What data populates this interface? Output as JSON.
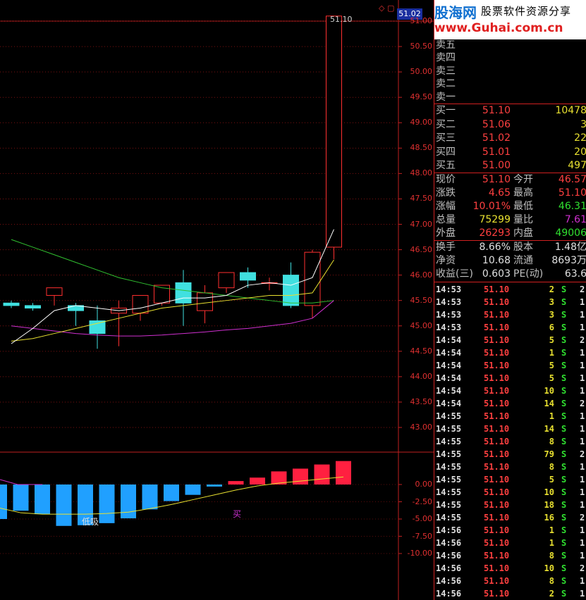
{
  "chart": {
    "current_price_tag": "51.02",
    "top_price_label": "51.10",
    "top_icons": "◇ ▢",
    "price_axis": [
      "51.00",
      "50.50",
      "50.00",
      "49.50",
      "49.00",
      "48.50",
      "48.00",
      "47.50",
      "47.00",
      "46.50",
      "46.00",
      "45.50",
      "45.00",
      "44.50",
      "44.00",
      "43.50",
      "43.00"
    ],
    "macd_axis": [
      "0.00",
      "-2.50",
      "-5.00",
      "-7.50",
      "-10.00"
    ],
    "signal_low": "低吸",
    "signal_buy": "买",
    "colors": {
      "up": "#ff3030",
      "down": "#40e0e0",
      "ma5": "#ffffff",
      "ma10": "#e8e030",
      "ma20": "#30c030",
      "ma60": "#d030d0"
    }
  },
  "panel": {
    "logo": {
      "site": "股海网",
      "tagline": "股票软件资源分享",
      "url": "www.Guhai.com.cn"
    },
    "sell": [
      {
        "label": "卖五",
        "price": "",
        "vol": ""
      },
      {
        "label": "卖四",
        "price": "",
        "vol": ""
      },
      {
        "label": "卖三",
        "price": "",
        "vol": ""
      },
      {
        "label": "卖二",
        "price": "",
        "vol": ""
      },
      {
        "label": "卖一",
        "price": "",
        "vol": ""
      }
    ],
    "buy": [
      {
        "label": "买一",
        "price": "51.10",
        "vol": "10478"
      },
      {
        "label": "买二",
        "price": "51.06",
        "vol": "3"
      },
      {
        "label": "买三",
        "price": "51.02",
        "vol": "22"
      },
      {
        "label": "买四",
        "price": "51.01",
        "vol": "20"
      },
      {
        "label": "买五",
        "price": "51.00",
        "vol": "497"
      }
    ],
    "quote": [
      {
        "l1": "现价",
        "v1": "51.10",
        "c1": "c-red",
        "l2": "今开",
        "v2": "46.57",
        "c2": "c-red"
      },
      {
        "l1": "涨跌",
        "v1": "4.65",
        "c1": "c-red",
        "l2": "最高",
        "v2": "51.10",
        "c2": "c-red"
      },
      {
        "l1": "涨幅",
        "v1": "10.01%",
        "c1": "c-red",
        "l2": "最低",
        "v2": "46.31",
        "c2": "c-green"
      },
      {
        "l1": "总量",
        "v1": "75299",
        "c1": "c-yel",
        "l2": "量比",
        "v2": "7.61",
        "c2": "c-mag"
      },
      {
        "l1": "外盘",
        "v1": "26293",
        "c1": "c-red",
        "l2": "内盘",
        "v2": "49006",
        "c2": "c-green"
      }
    ],
    "fund": [
      {
        "l1": "换手",
        "v1": "8.66%",
        "l2": "股本",
        "v2": "1.48亿"
      },
      {
        "l1": "净资",
        "v1": "10.68",
        "l2": "流通",
        "v2": "8693万"
      },
      {
        "l1": "收益(三)",
        "v1": "0.603",
        "l2": "PE(动)",
        "v2": "63.6"
      }
    ],
    "ticks": [
      {
        "t": "14:53",
        "p": "51.10",
        "v": "2",
        "s": "S",
        "x": "2"
      },
      {
        "t": "14:53",
        "p": "51.10",
        "v": "3",
        "s": "S",
        "x": "1"
      },
      {
        "t": "14:53",
        "p": "51.10",
        "v": "3",
        "s": "S",
        "x": "1"
      },
      {
        "t": "14:53",
        "p": "51.10",
        "v": "6",
        "s": "S",
        "x": "1"
      },
      {
        "t": "14:54",
        "p": "51.10",
        "v": "5",
        "s": "S",
        "x": "2"
      },
      {
        "t": "14:54",
        "p": "51.10",
        "v": "1",
        "s": "S",
        "x": "1"
      },
      {
        "t": "14:54",
        "p": "51.10",
        "v": "5",
        "s": "S",
        "x": "1"
      },
      {
        "t": "14:54",
        "p": "51.10",
        "v": "5",
        "s": "S",
        "x": "1"
      },
      {
        "t": "14:54",
        "p": "51.10",
        "v": "10",
        "s": "S",
        "x": "1"
      },
      {
        "t": "14:54",
        "p": "51.10",
        "v": "14",
        "s": "S",
        "x": "2"
      },
      {
        "t": "14:55",
        "p": "51.10",
        "v": "1",
        "s": "S",
        "x": "1"
      },
      {
        "t": "14:55",
        "p": "51.10",
        "v": "14",
        "s": "S",
        "x": "1"
      },
      {
        "t": "14:55",
        "p": "51.10",
        "v": "8",
        "s": "S",
        "x": "1"
      },
      {
        "t": "14:55",
        "p": "51.10",
        "v": "79",
        "s": "S",
        "x": "2"
      },
      {
        "t": "14:55",
        "p": "51.10",
        "v": "8",
        "s": "S",
        "x": "1"
      },
      {
        "t": "14:55",
        "p": "51.10",
        "v": "5",
        "s": "S",
        "x": "1"
      },
      {
        "t": "14:55",
        "p": "51.10",
        "v": "10",
        "s": "S",
        "x": "1"
      },
      {
        "t": "14:55",
        "p": "51.10",
        "v": "18",
        "s": "S",
        "x": "1"
      },
      {
        "t": "14:55",
        "p": "51.10",
        "v": "16",
        "s": "S",
        "x": "2"
      },
      {
        "t": "14:56",
        "p": "51.10",
        "v": "1",
        "s": "S",
        "x": "1"
      },
      {
        "t": "14:56",
        "p": "51.10",
        "v": "1",
        "s": "S",
        "x": "1"
      },
      {
        "t": "14:56",
        "p": "51.10",
        "v": "8",
        "s": "S",
        "x": "1"
      },
      {
        "t": "14:56",
        "p": "51.10",
        "v": "10",
        "s": "S",
        "x": "2"
      },
      {
        "t": "14:56",
        "p": "51.10",
        "v": "8",
        "s": "S",
        "x": "1"
      },
      {
        "t": "14:56",
        "p": "51.10",
        "v": "2",
        "s": "S",
        "x": "1"
      }
    ]
  },
  "chart_data": {
    "type": "candlestick",
    "candles": [
      {
        "o": 45.45,
        "c": 45.4,
        "h": 45.5,
        "l": 45.35
      },
      {
        "o": 45.4,
        "c": 45.35,
        "h": 45.45,
        "l": 45.3
      },
      {
        "o": 45.6,
        "c": 45.75,
        "h": 45.75,
        "l": 45.4
      },
      {
        "o": 45.4,
        "c": 45.3,
        "h": 45.45,
        "l": 45.0
      },
      {
        "o": 45.1,
        "c": 44.85,
        "h": 45.4,
        "l": 44.55
      },
      {
        "o": 45.25,
        "c": 45.35,
        "h": 45.5,
        "l": 44.6
      },
      {
        "o": 45.25,
        "c": 45.6,
        "h": 45.6,
        "l": 45.1
      },
      {
        "o": 45.45,
        "c": 45.8,
        "h": 45.8,
        "l": 45.4
      },
      {
        "o": 45.85,
        "c": 45.45,
        "h": 46.1,
        "l": 45.0
      },
      {
        "o": 45.3,
        "c": 45.65,
        "h": 45.8,
        "l": 45.05
      },
      {
        "o": 45.75,
        "c": 46.05,
        "h": 46.05,
        "l": 45.65
      },
      {
        "o": 46.05,
        "c": 45.9,
        "h": 46.15,
        "l": 45.75
      },
      {
        "o": 45.85,
        "c": 45.85,
        "h": 45.95,
        "l": 45.7
      },
      {
        "o": 46.0,
        "c": 45.4,
        "h": 46.25,
        "l": 45.35
      },
      {
        "o": 45.4,
        "c": 46.45,
        "h": 46.5,
        "l": 45.15
      },
      {
        "o": 46.55,
        "c": 51.1,
        "h": 51.1,
        "l": 46.31
      }
    ],
    "macd_hist": [
      -5.0,
      -3.8,
      -4.3,
      -6.0,
      -5.9,
      -5.6,
      -4.9,
      -3.6,
      -2.4,
      -1.5,
      -0.3,
      0.5,
      1.0,
      1.9,
      2.3,
      2.9,
      3.4
    ],
    "ylim": [
      42.8,
      51.2
    ]
  }
}
